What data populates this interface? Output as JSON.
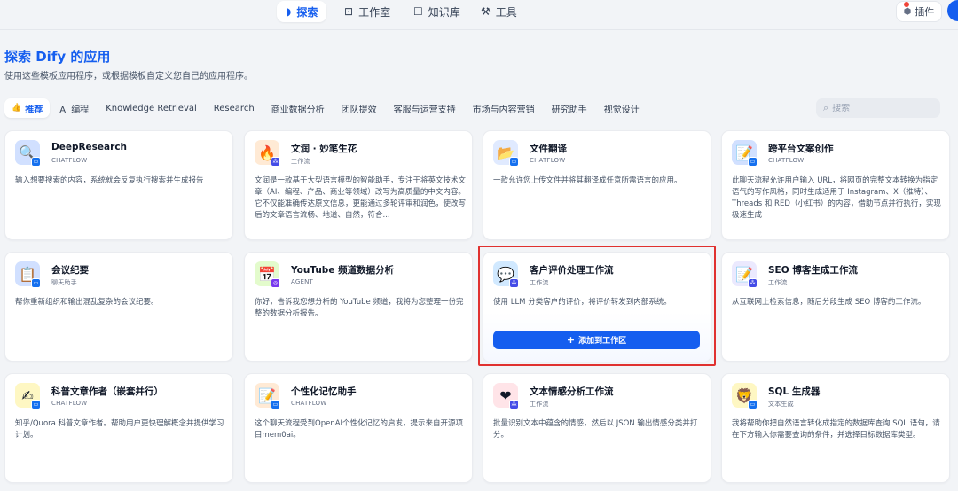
{
  "nav": {
    "items": [
      {
        "label": "探索",
        "icon": "compass-icon",
        "glyph": "◗",
        "active": true
      },
      {
        "label": "工作室",
        "icon": "robot-icon",
        "glyph": "⊡",
        "active": false
      },
      {
        "label": "知识库",
        "icon": "book-icon",
        "glyph": "☐",
        "active": false
      },
      {
        "label": "工具",
        "icon": "hammer-icon",
        "glyph": "⚒",
        "active": false
      }
    ],
    "plugins_label": "插件",
    "plugin_glyph": "⬢"
  },
  "header": {
    "title": "探索 Dify 的应用",
    "subtitle": "使用这些模板应用程序，或根据模板自定义您自己的应用程序。"
  },
  "tabs": [
    {
      "label": "推荐",
      "active": true,
      "glyph": "👍"
    },
    {
      "label": "AI 编程"
    },
    {
      "label": "Knowledge Retrieval"
    },
    {
      "label": "Research"
    },
    {
      "label": "商业数据分析"
    },
    {
      "label": "团队提效"
    },
    {
      "label": "客服与运营支持"
    },
    {
      "label": "市场与内容营销"
    },
    {
      "label": "研究助手"
    },
    {
      "label": "视觉设计"
    }
  ],
  "search": {
    "placeholder": "搜索",
    "glyph": "⌕"
  },
  "cards": [
    {
      "name": "DeepResearch",
      "type": "CHATFLOW",
      "kind": "chatflow",
      "emoji": "🔍",
      "bg": "#d1e0ff",
      "desc": "输入想要搜索的内容，系统就会反复执行搜索并生成报告"
    },
    {
      "name": "文润 · 妙笔生花",
      "type": "工作流",
      "kind": "workflow",
      "emoji": "🔥",
      "bg": "#ffead5",
      "desc": "文润是一款基于大型语言模型的智能助手，专注于将英文技术文章（AI、编程、产品、商业等领域）改写为高质量的中文内容。它不仅能准确传达原文信息，更能通过多轮评审和润色，使改写后的文章语言流畅、地道、自然，符合..."
    },
    {
      "name": "文件翻译",
      "type": "CHATFLOW",
      "kind": "chatflow",
      "emoji": "📂",
      "bg": "#e0eaff",
      "desc": "一款允许您上传文件并将其翻译成任意所需语言的应用。"
    },
    {
      "name": "跨平台文案创作",
      "type": "CHATFLOW",
      "kind": "chatflow",
      "emoji": "📝",
      "bg": "#d1e0ff",
      "desc": "此聊天流程允许用户输入 URL，将网页的完整文本转换为指定语气的写作风格，同时生成适用于 Instagram、X（推特）、Threads 和 RED（小红书）的内容，借助节点并行执行，实现极速生成"
    },
    {
      "name": "会议纪要",
      "type": "聊天助手",
      "kind": "chat",
      "emoji": "📋",
      "bg": "#d1e0ff",
      "desc": "帮你重新组织和输出混乱复杂的会议纪要。"
    },
    {
      "name": "YouTube 频道数据分析",
      "type": "AGENT",
      "kind": "agent",
      "emoji": "📅",
      "bg": "#e3fbcc",
      "desc": "你好，告诉我您想分析的 YouTube 频道，我将为您整理一份完整的数据分析报告。"
    },
    {
      "name": "客户评价处理工作流",
      "type": "工作流",
      "kind": "workflow",
      "emoji": "💬",
      "bg": "#d1e9ff",
      "desc": "使用 LLM 分类客户的评价，将评价转发到内部系统。"
    },
    {
      "name": "SEO 博客生成工作流",
      "type": "工作流",
      "kind": "workflow",
      "emoji": "📝",
      "bg": "#ebe9fe",
      "desc": "从互联网上检索信息，随后分段生成 SEO 博客的工作流。"
    },
    {
      "name": "科普文章作者（嵌套并行）",
      "type": "CHATFLOW",
      "kind": "chatflow",
      "emoji": "✍",
      "bg": "#fef7c3",
      "desc": "知乎/Quora 科普文章作者。帮助用户更快理解概念并提供学习计划。"
    },
    {
      "name": "个性化记忆助手",
      "type": "CHATFLOW",
      "kind": "chatflow",
      "emoji": "📝",
      "bg": "#ffead5",
      "desc": "这个聊天流程受到OpenAI个性化记忆的启发，提示来自开源项目mem0ai。"
    },
    {
      "name": "文本情感分析工作流",
      "type": "工作流",
      "kind": "workflow",
      "emoji": "❤",
      "bg": "#ffe4e8",
      "desc": "批量识别文本中蕴含的情感，然后以 JSON 输出情感分类并打分。"
    },
    {
      "name": "SQL 生成器",
      "type": "文本生成",
      "kind": "chat",
      "emoji": "🦁",
      "bg": "#fef7c3",
      "desc": "我将帮助你把自然语言转化成指定的数据库查询 SQL 语句，请在下方输入你需要查询的条件，并选择目标数据库类型。"
    }
  ],
  "add_button": {
    "label": "添加到工作区",
    "glyph": "+"
  }
}
